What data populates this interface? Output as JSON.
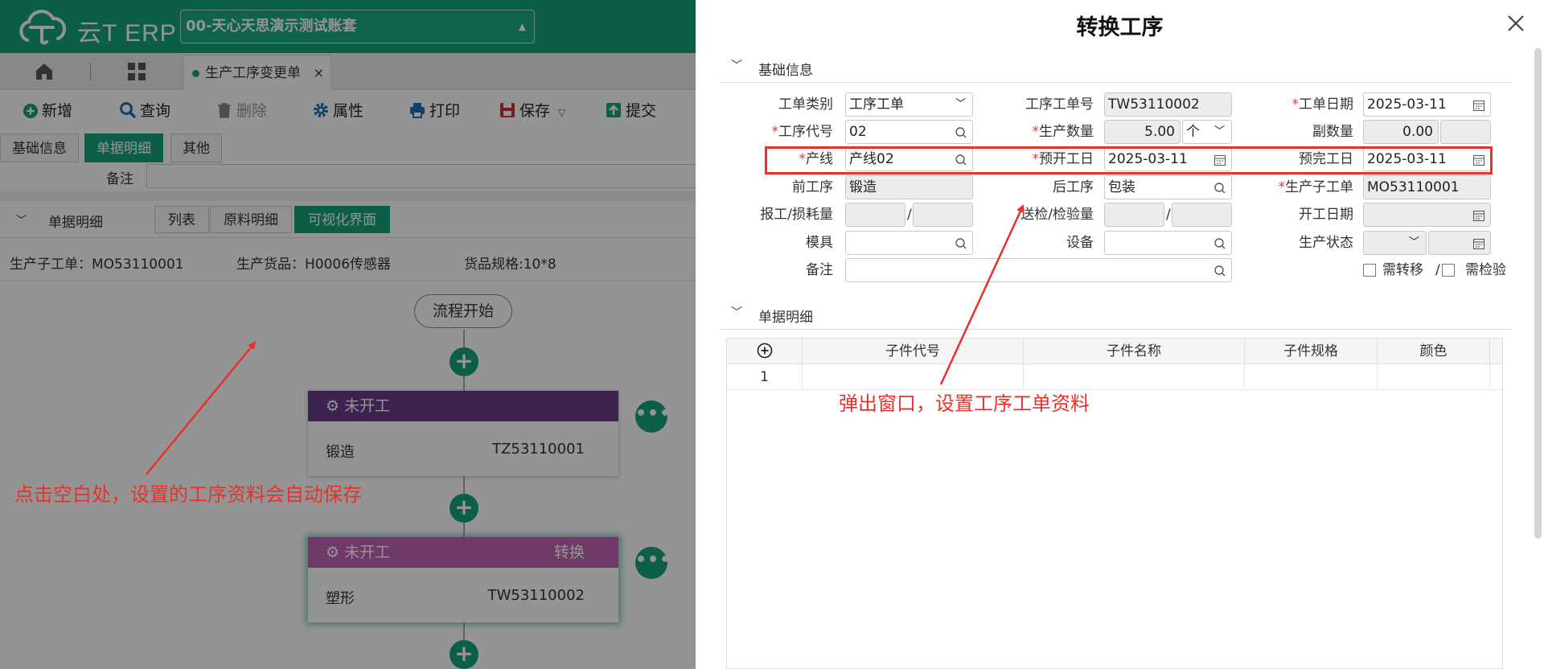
{
  "app": {
    "brand": "云T ERP",
    "account": "00-天心天思演示测试账套",
    "tabs": {
      "doc_tab": "生产工序变更单",
      "close": "×"
    },
    "toolbar": {
      "new": "新增",
      "query": "查询",
      "delete": "删除",
      "properties": "属性",
      "print": "打印",
      "save": "保存",
      "submit": "提交"
    },
    "subtabs": [
      "基础信息",
      "单据明细",
      "其他"
    ],
    "remark_label": "备注",
    "detail": {
      "title": "单据明细",
      "view_tabs": [
        "列表",
        "原料明细",
        "可视化界面"
      ]
    },
    "info": {
      "sub_order": "生产子工单：MO53110001",
      "product": "生产货品：H0006传感器",
      "spec": "货品规格:10*8"
    },
    "flow": {
      "start": "流程开始",
      "cards": [
        {
          "status": "未开工",
          "switch": "",
          "name": "锻造",
          "code": "TZ53110001",
          "header_color": "#6a3f8a"
        },
        {
          "status": "未开工",
          "switch": "转换",
          "name": "塑形",
          "code": "TW53110002",
          "header_color": "#c064b2"
        }
      ]
    }
  },
  "dialog": {
    "title": "转换工序",
    "basic_section": "基础信息",
    "detail_section": "单据明细",
    "fields": {
      "order_type": {
        "label": "工单类别",
        "value": "工序工单"
      },
      "order_no": {
        "label": "工序工单号",
        "value": "TW53110002"
      },
      "order_date": {
        "label": "工单日期",
        "value": "2025-03-11",
        "required": "*"
      },
      "process_code": {
        "label": "工序代号",
        "value": "02",
        "required": "*"
      },
      "qty": {
        "label": "生产数量",
        "value": "5.00",
        "unit": "个",
        "required": "*"
      },
      "sub_qty": {
        "label": "副数量",
        "value": "0.00"
      },
      "line": {
        "label": "产线",
        "value": "产线02",
        "required": "*"
      },
      "plan_start": {
        "label": "预开工日",
        "value": "2025-03-11",
        "required": "*"
      },
      "plan_end": {
        "label": "预完工日",
        "value": "2025-03-11"
      },
      "prev_proc": {
        "label": "前工序",
        "value": "锻造"
      },
      "next_proc": {
        "label": "后工序",
        "value": "包装"
      },
      "sub_order": {
        "label": "生产子工单",
        "value": "MO53110001",
        "required": "*"
      },
      "report_loss": {
        "label": "报工/损耗量",
        "value": ""
      },
      "inspect_qty": {
        "label": "送检/检验量",
        "value": ""
      },
      "start_date": {
        "label": "开工日期",
        "value": ""
      },
      "mold": {
        "label": "模具",
        "value": ""
      },
      "equipment": {
        "label": "设备",
        "value": ""
      },
      "prod_status": {
        "label": "生产状态",
        "value": ""
      },
      "remark": {
        "label": "备注",
        "value": ""
      },
      "need_transfer": "需转移",
      "need_inspect": "需检验",
      "slash": "/"
    },
    "grid": {
      "headers": [
        "子件代号",
        "子件名称",
        "子件规格",
        "颜色"
      ],
      "rows": [
        {
          "no": "1"
        }
      ]
    }
  },
  "annotations": {
    "left": "点击空白处，设置的工序资料会自动保存",
    "right": "弹出窗口，设置工序工单资料"
  },
  "colors": {
    "brand": "#16a37c",
    "annotation": "#e8312a"
  }
}
